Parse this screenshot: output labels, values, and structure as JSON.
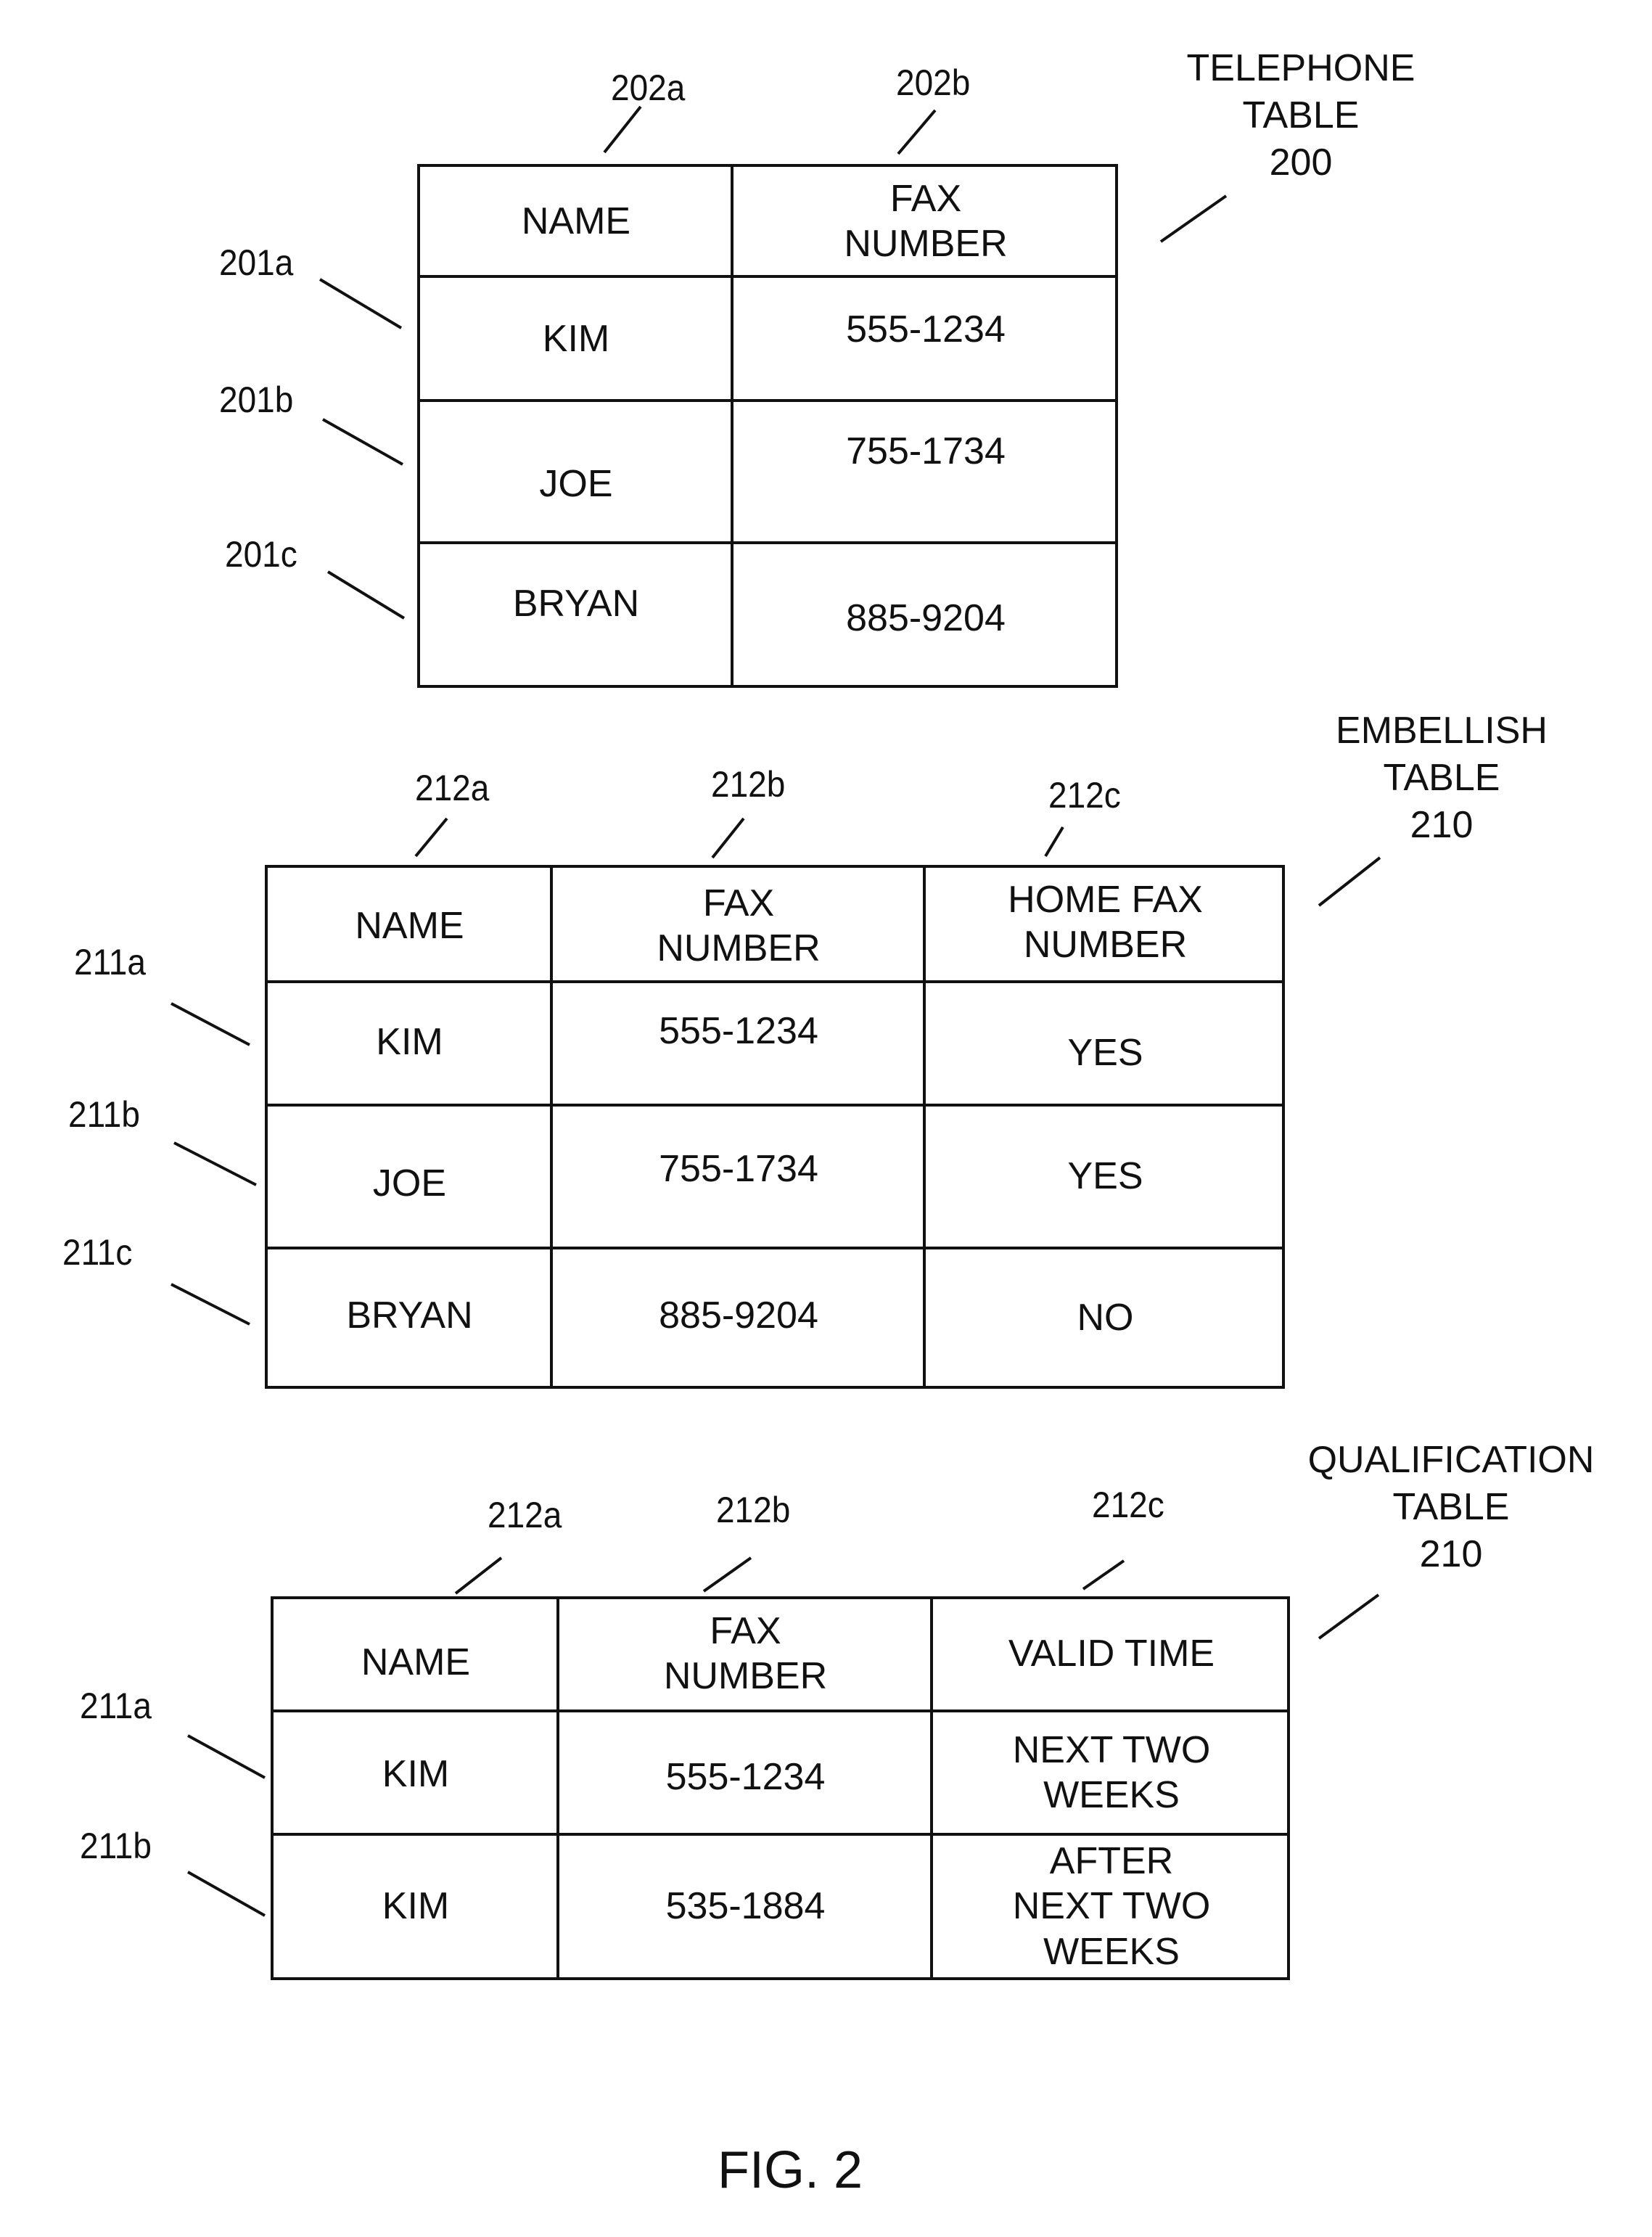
{
  "figure_label": "FIG. 2",
  "telephone_table": {
    "title_lines": [
      "TELEPHONE",
      "TABLE",
      "200"
    ],
    "column_refs": [
      "202a",
      "202b"
    ],
    "row_refs": [
      "201a",
      "201b",
      "201c"
    ],
    "headers": [
      [
        "NAME"
      ],
      [
        "FAX",
        "NUMBER"
      ]
    ],
    "rows": [
      [
        "KIM",
        "555-1234"
      ],
      [
        "JOE",
        "755-1734"
      ],
      [
        "BRYAN",
        "885-9204"
      ]
    ]
  },
  "embellish_table": {
    "title_lines": [
      "EMBELLISH",
      "TABLE",
      "210"
    ],
    "column_refs": [
      "212a",
      "212b",
      "212c"
    ],
    "row_refs": [
      "211a",
      "211b",
      "211c"
    ],
    "headers": [
      [
        "NAME"
      ],
      [
        "FAX",
        "NUMBER"
      ],
      [
        "HOME FAX",
        "NUMBER"
      ]
    ],
    "rows": [
      [
        "KIM",
        "555-1234",
        "YES"
      ],
      [
        "JOE",
        "755-1734",
        "YES"
      ],
      [
        "BRYAN",
        "885-9204",
        "NO"
      ]
    ]
  },
  "qualification_table": {
    "title_lines": [
      "QUALIFICATION",
      "TABLE",
      "210"
    ],
    "column_refs": [
      "212a",
      "212b",
      "212c"
    ],
    "row_refs": [
      "211a",
      "211b"
    ],
    "headers": [
      [
        "NAME"
      ],
      [
        "FAX",
        "NUMBER"
      ],
      [
        "VALID TIME"
      ]
    ],
    "rows": [
      [
        [
          "KIM"
        ],
        [
          "555-1234"
        ],
        [
          "NEXT TWO",
          "WEEKS"
        ]
      ],
      [
        [
          "KIM"
        ],
        [
          "535-1884"
        ],
        [
          "AFTER",
          "NEXT TWO",
          "WEEKS"
        ]
      ]
    ]
  }
}
